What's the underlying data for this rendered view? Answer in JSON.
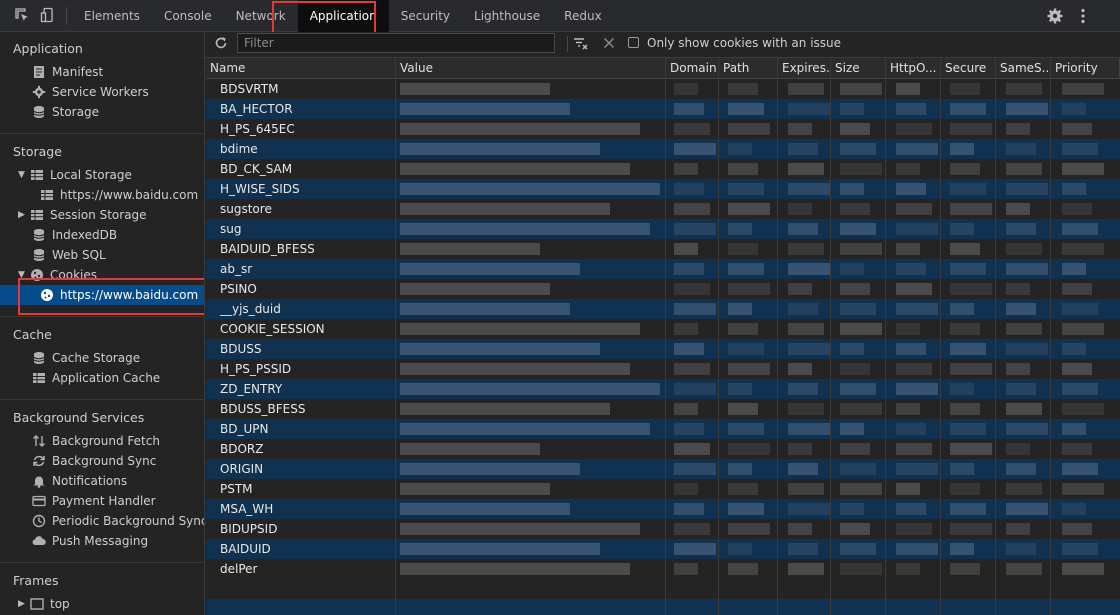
{
  "tabs": [
    {
      "label": "Elements",
      "active": false
    },
    {
      "label": "Console",
      "active": false
    },
    {
      "label": "Network",
      "active": false
    },
    {
      "label": "Application",
      "active": true
    },
    {
      "label": "Security",
      "active": false
    },
    {
      "label": "Lighthouse",
      "active": false
    },
    {
      "label": "Redux",
      "active": false
    }
  ],
  "icons": {
    "inspect": "inspect-icon",
    "device": "device-toolbar-icon",
    "settings": "gear-icon",
    "more": "kebab-menu-icon"
  },
  "sidebar": {
    "application": {
      "heading": "Application",
      "items": [
        "Manifest",
        "Service Workers",
        "Storage"
      ]
    },
    "storage": {
      "heading": "Storage",
      "local_storage": "Local Storage",
      "local_storage_child": "https://www.baidu.com",
      "session_storage": "Session Storage",
      "indexeddb": "IndexedDB",
      "websql": "Web SQL",
      "cookies": "Cookies",
      "cookies_child": "https://www.baidu.com"
    },
    "cache": {
      "heading": "Cache",
      "items": [
        "Cache Storage",
        "Application Cache"
      ]
    },
    "background": {
      "heading": "Background Services",
      "items": [
        "Background Fetch",
        "Background Sync",
        "Notifications",
        "Payment Handler",
        "Periodic Background Sync",
        "Push Messaging"
      ]
    },
    "frames": {
      "heading": "Frames",
      "top": "top"
    }
  },
  "toolbar": {
    "filter_placeholder": "Filter",
    "only_issue_label": "Only show cookies with an issue"
  },
  "columns": [
    "Name",
    "Value",
    "Domain",
    "Path",
    "Expires...",
    "Size",
    "HttpO...",
    "Secure",
    "SameS...",
    "Priority"
  ],
  "cookies": [
    "BDSVRTM",
    "BA_HECTOR",
    "H_PS_645EC",
    "bdime",
    "BD_CK_SAM",
    "H_WISE_SIDS",
    "sugstore",
    "sug",
    "BAIDUID_BFESS",
    "ab_sr",
    "PSINO",
    "__yjs_duid",
    "COOKIE_SESSION",
    "BDUSS",
    "H_PS_PSSID",
    "ZD_ENTRY",
    "BDUSS_BFESS",
    "BD_UPN",
    "BDORZ",
    "ORIGIN",
    "PSTM",
    "MSA_WH",
    "BIDUPSID",
    "BAIDUID",
    "delPer"
  ],
  "colors": {
    "accent": "#074c8a",
    "highlight": "#e53935",
    "row_alt": "#10314f"
  }
}
